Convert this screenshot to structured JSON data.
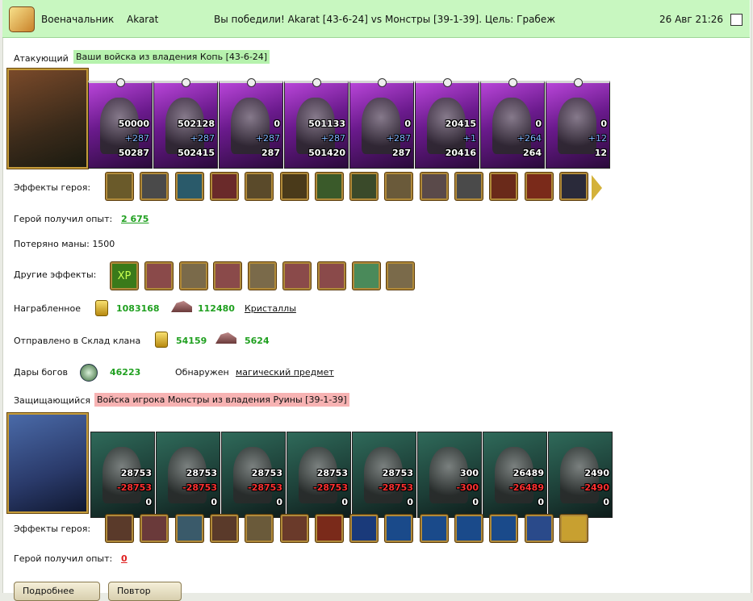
{
  "header": {
    "role": "Военачальник",
    "player": "Akarat",
    "result": "Вы победили! Akarat [43-6-24] vs Монстры [39-1-39]. Цель: Грабеж",
    "datetime": "26 Авг 21:26"
  },
  "attacker": {
    "label": "Атакующий",
    "desc": "Ваши войска из владения Копь [43-6-24]",
    "units": [
      {
        "top": "50000",
        "mid": "+287",
        "bot": "50287"
      },
      {
        "top": "502128",
        "mid": "+287",
        "bot": "502415"
      },
      {
        "top": "0",
        "mid": "+287",
        "bot": "287"
      },
      {
        "top": "501133",
        "mid": "+287",
        "bot": "501420"
      },
      {
        "top": "0",
        "mid": "+287",
        "bot": "287"
      },
      {
        "top": "20415",
        "mid": "+1",
        "bot": "20416"
      },
      {
        "top": "0",
        "mid": "+264",
        "bot": "264"
      },
      {
        "top": "0",
        "mid": "+12",
        "bot": "12"
      }
    ],
    "effects_label": "Эффекты героя:",
    "effects_icons": [
      "helm-icon",
      "armor-icon",
      "shield-icon",
      "skull-icon",
      "amulet-icon",
      "gloves-icon",
      "mask-icon",
      "boots-icon",
      "ring-icon",
      "dagger-icon",
      "sword-icon",
      "emblem-icon",
      "scroll-icon",
      "cloak-icon"
    ],
    "exp_label": "Герой получил опыт:",
    "exp_value": "2 675",
    "mana_label": "Потеряно маны: 1500",
    "other_label": "Другие эффекты:",
    "other_icons": [
      "xp-icon",
      "fist-sword-icon",
      "sword-icon",
      "fist-sword-icon",
      "sword-icon",
      "fist-sword-icon",
      "fist-sword-icon",
      "green-sword-icon",
      "sword-icon"
    ],
    "loot_label": "Награбленное",
    "loot_gold": "1083168",
    "loot_ore": "112480",
    "loot_crystals": "Кристаллы",
    "clan_label": "Отправлено в Склад клана",
    "clan_gold": "54159",
    "clan_ore": "5624",
    "gifts_label": "Дары богов",
    "gifts_value": "46223",
    "found_label": "Обнаружен",
    "found_item": "магический предмет"
  },
  "defender": {
    "label": "Защищающийся",
    "desc": "Войска игрока Монстры из владения Руины [39-1-39]",
    "units": [
      {
        "top": "28753",
        "mid": "-28753",
        "bot": "0"
      },
      {
        "top": "28753",
        "mid": "-28753",
        "bot": "0"
      },
      {
        "top": "28753",
        "mid": "-28753",
        "bot": "0"
      },
      {
        "top": "28753",
        "mid": "-28753",
        "bot": "0"
      },
      {
        "top": "28753",
        "mid": "-28753",
        "bot": "0"
      },
      {
        "top": "300",
        "mid": "-300",
        "bot": "0"
      },
      {
        "top": "26489",
        "mid": "-26489",
        "bot": "0"
      },
      {
        "top": "2490",
        "mid": "-2490",
        "bot": "0"
      }
    ],
    "effects_label": "Эффекты героя:",
    "effects_icons": [
      "helm-icon",
      "arrow-icon",
      "shield-icon",
      "dwarf-icon",
      "armor-icon",
      "hammer-icon",
      "beast-icon",
      "frost-icon",
      "frost-armor-icon",
      "frost-ring-icon",
      "frost-axe-icon",
      "frost-hammer-icon",
      "crystal-icon",
      "gold-frost-icon"
    ],
    "exp_label": "Герой получил опыт:",
    "exp_value": "0"
  },
  "buttons": {
    "b1": "Подробнее",
    "b2": "Повтор"
  },
  "colors": {
    "header": "#c8f7c0",
    "green": "#20a020",
    "red": "#e02020",
    "att_bg": "#b845d8",
    "def_bg": "#2f6a5a"
  }
}
